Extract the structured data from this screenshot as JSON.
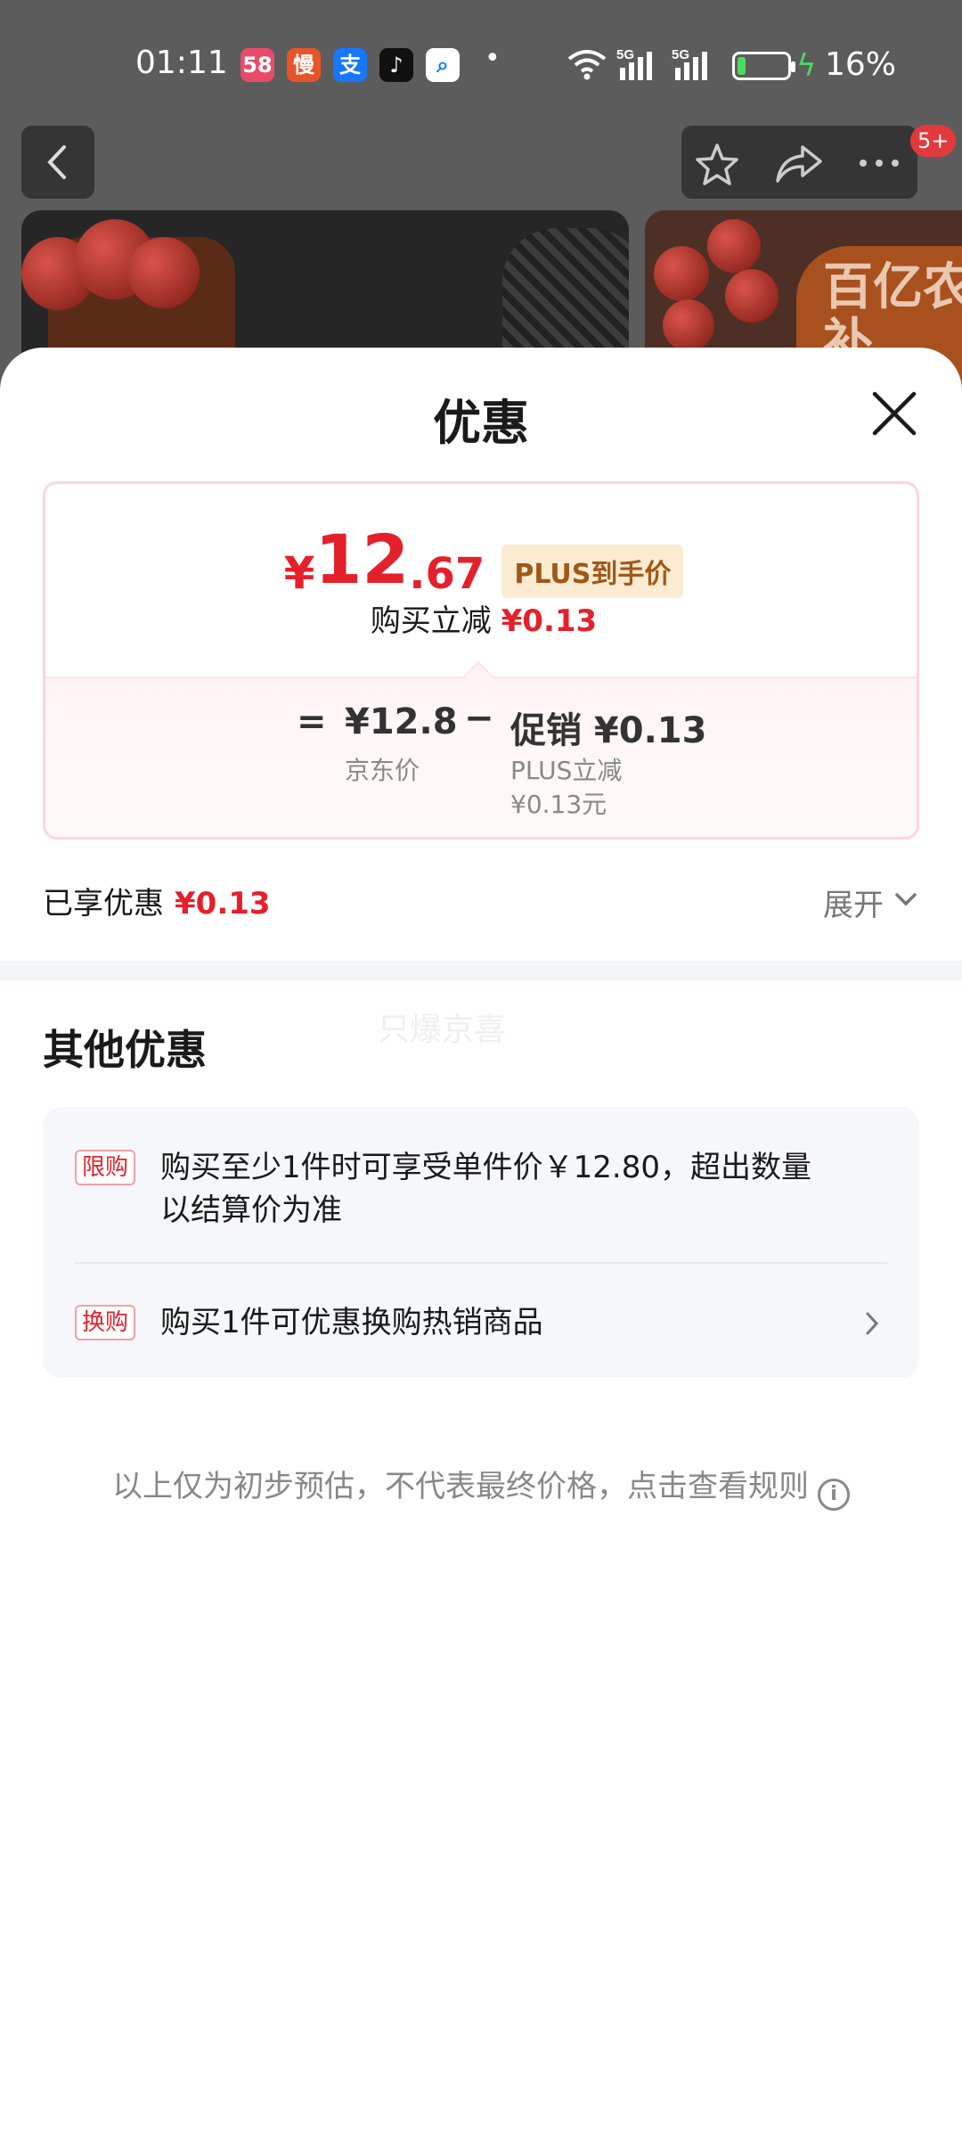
{
  "status_bar": {
    "time": "01:11",
    "battery_percent": "16%",
    "network_1": "5G",
    "network_2": "5G",
    "battery_level": 0.16,
    "apps": [
      {
        "icon": "app-icon-pink",
        "glyph": "58",
        "color": "#e84b6a"
      },
      {
        "icon": "app-icon-orange",
        "glyph": "慢",
        "color": "#e8542a"
      },
      {
        "icon": "alipay-icon",
        "glyph": "支",
        "color": "#1677ff"
      },
      {
        "icon": "tiktok-icon",
        "glyph": "♪",
        "color": "#111111"
      },
      {
        "icon": "search-app-icon",
        "glyph": "⌕",
        "color": "#ffffff"
      }
    ]
  },
  "header": {
    "badge": "5+",
    "promo_text": "百亿农补"
  },
  "sheet": {
    "title": "优惠",
    "price": {
      "yen": "¥",
      "integer": "12",
      "decimal": ".67",
      "tag": "PLUS到手价",
      "reduce_label": "购买立减",
      "reduce_value": "¥0.13"
    },
    "breakdown": {
      "equals": "=",
      "jd_price": "¥12.8",
      "jd_price_label": "京东价",
      "minus": "−",
      "promo_value": "促销 ¥0.13",
      "promo_detail_1": "PLUS立减",
      "promo_detail_2": "¥0.13元"
    },
    "enjoyed_label": "已享优惠",
    "enjoyed_value": "¥0.13",
    "expand_label": "展开",
    "other_title": "其他优惠",
    "watermark": "只爆京喜",
    "other_items": [
      {
        "tag": "限购",
        "text": "购买至少1件时可享受单件价￥12.80，超出数量以结算价为准"
      },
      {
        "tag": "换购",
        "text": "购买1件可优惠换购热销商品"
      }
    ],
    "footnote": "以上仅为初步预估，不代表最终价格，点击查看规则",
    "info_glyph": "i"
  },
  "colors": {
    "accent_red": "#e4212b",
    "plus_gold": "#a0581a",
    "card_border": "#fbd6dd"
  }
}
